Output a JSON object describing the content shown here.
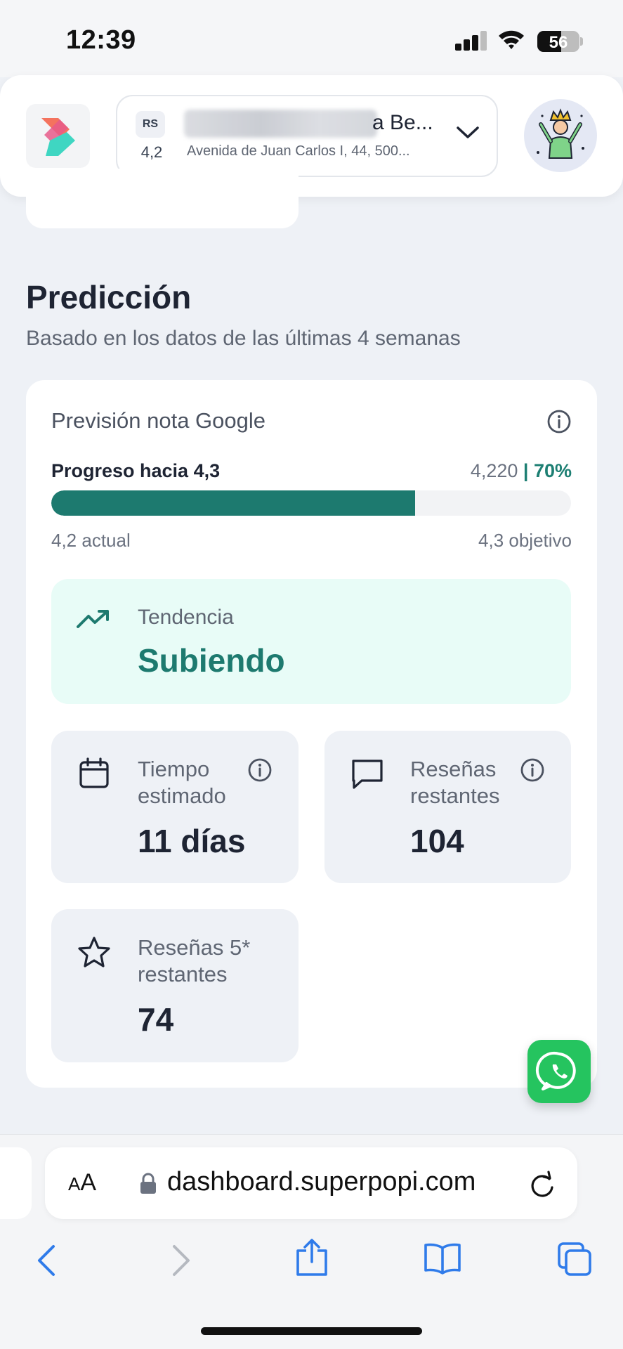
{
  "status_bar": {
    "time": "12:39",
    "battery": "56",
    "battery_level": 0.56
  },
  "header": {
    "rating_badge": "RS",
    "rating": "4,2",
    "business_name_visible": "a Be...",
    "address": "Avenida de Juan Carlos I, 44, 500..."
  },
  "section": {
    "title": "Predicción",
    "subtitle": "Basado en los datos de las últimas 4 semanas"
  },
  "card": {
    "title": "Previsión nota Google",
    "progress_label": "Progreso hacia 4,3",
    "progress_value": "4,220",
    "progress_separator": " | ",
    "progress_percent": "70%",
    "progress_fraction": 0.7,
    "current_label": "4,2 actual",
    "target_label": "4,3 objetivo",
    "trend": {
      "label": "Tendencia",
      "value": "Subiendo"
    },
    "stats": {
      "time": {
        "label_line1": "Tiempo",
        "label_line2": "estimado",
        "value": "11 días"
      },
      "reviews": {
        "label_line1": "Reseñas",
        "label_line2": "restantes",
        "value": "104"
      },
      "five_star": {
        "label_line1": "Reseñas 5*",
        "label_line2": "restantes",
        "value": "74"
      }
    }
  },
  "browser": {
    "text_size_label_small": "A",
    "text_size_label_large": "A",
    "url": "dashboard.superpopi.com"
  },
  "colors": {
    "accent": "#1d7a6f",
    "trend_bg": "#e8fcf7",
    "whatsapp": "#25c45f",
    "ios_blue": "#2f7bea"
  },
  "icons": {
    "info": "info-icon",
    "trend": "trending-up-icon",
    "calendar": "calendar-icon",
    "message": "message-icon",
    "star": "star-icon",
    "whatsapp": "whatsapp-icon"
  }
}
